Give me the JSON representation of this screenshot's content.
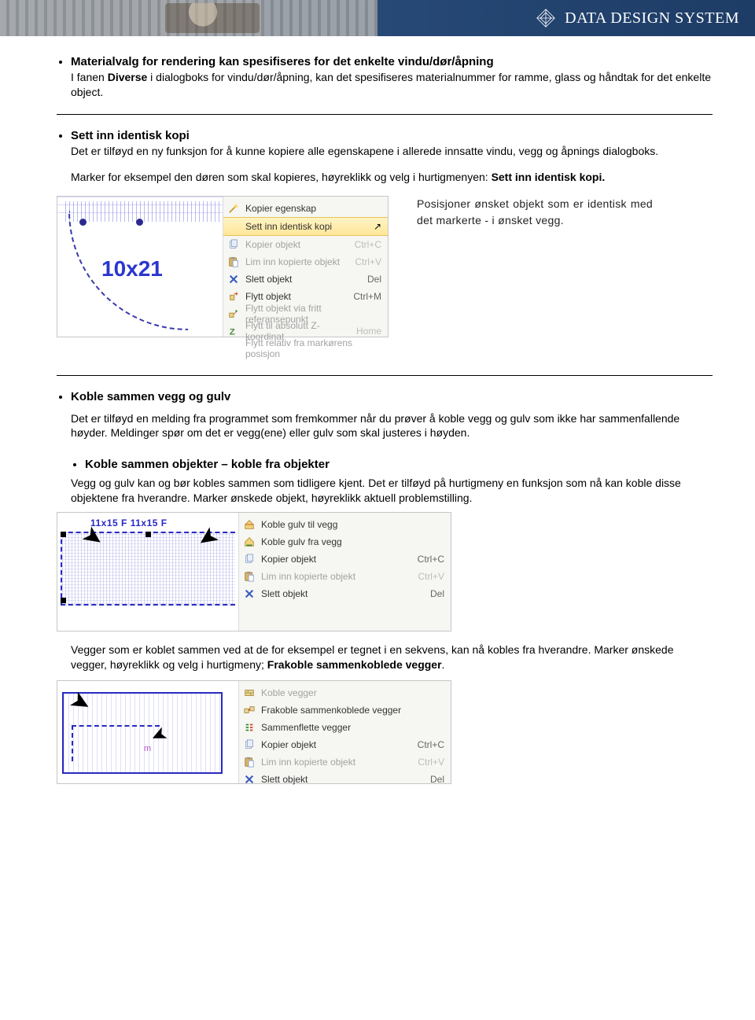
{
  "brand": "DATA DESIGN SYSTEM",
  "sections": {
    "s1": {
      "title": "Materialvalg for rendering kan spesifiseres for det enkelte vindu/dør/åpning",
      "body_pre": "I fanen ",
      "body_b": "Diverse",
      "body_post": " i dialogboks for vindu/dør/åpning, kan det spesifiseres materialnummer for ramme, glass og håndtak for det enkelte object."
    },
    "s2": {
      "title": "Sett inn identisk kopi",
      "p1": "Det er tilføyd en ny funksjon for å kunne kopiere alle egenskapene i allerede innsatte vindu, vegg og åpnings dialogboks.",
      "p2_pre": "Marker for eksempel den døren som skal kopieres, høyreklikk og velg i hurtigmenyen: ",
      "p2_b": "Sett inn identisk kopi.",
      "door_label": "10x21",
      "caption": "Posisjoner ønsket objekt som er identisk med det markerte - i ønsket vegg.",
      "menu": [
        {
          "icon": "wand",
          "label": "Kopier egenskap",
          "sc": "",
          "state": ""
        },
        {
          "icon": "",
          "label": "Sett inn identisk kopi",
          "sc": "",
          "state": "sel"
        },
        {
          "icon": "copy",
          "label": "Kopier objekt",
          "sc": "Ctrl+C",
          "state": "dis"
        },
        {
          "icon": "paste",
          "label": "Lim inn kopierte objekt",
          "sc": "Ctrl+V",
          "state": "dis"
        },
        {
          "icon": "x",
          "label": "Slett objekt",
          "sc": "Del",
          "state": ""
        },
        {
          "icon": "move",
          "label": "Flytt objekt",
          "sc": "Ctrl+M",
          "state": ""
        },
        {
          "icon": "moveref",
          "label": "Flytt objekt via fritt referansepunkt",
          "sc": "",
          "state": "dis"
        },
        {
          "icon": "z",
          "label": "Flytt til absolutt Z-koordinat",
          "sc": "Home",
          "state": "dis"
        },
        {
          "icon": "",
          "label": "Flytt relativ fra markørens posisjon",
          "sc": "",
          "state": "dis"
        }
      ]
    },
    "s3": {
      "title": "Koble sammen vegg og gulv",
      "p1": "Det er tilføyd en melding fra programmet som fremkommer når du prøver å koble vegg og gulv som ikke har sammenfallende høyder. Meldinger spør om det er vegg(ene) eller gulv som skal justeres i høyden.",
      "sub_title": "Koble sammen objekter – koble fra objekter",
      "p2": "Vegg og gulv kan og bør kobles sammen som tidligere kjent. Det er tilføyd på hurtigmeny en funksjon som nå kan koble disse objektene fra hverandre. Marker ønskede objekt, høyreklikk aktuell problemstilling.",
      "window_labels": "11x15 F   11x15 F",
      "menu2": [
        {
          "icon": "house",
          "label": "Koble gulv til vegg",
          "sc": "",
          "state": ""
        },
        {
          "icon": "house2",
          "label": "Koble gulv fra vegg",
          "sc": "",
          "state": ""
        },
        {
          "icon": "copy",
          "label": "Kopier objekt",
          "sc": "Ctrl+C",
          "state": ""
        },
        {
          "icon": "paste",
          "label": "Lim inn kopierte objekt",
          "sc": "Ctrl+V",
          "state": "dis"
        },
        {
          "icon": "x",
          "label": "Slett objekt",
          "sc": "Del",
          "state": ""
        }
      ],
      "p3_pre": "Vegger som er koblet sammen ved at de for eksempel er tegnet i en sekvens, kan nå kobles fra hverandre. Marker ønskede vegger, høyreklikk og velg i hurtigmeny; ",
      "p3_b": "Frakoble sammenkoblede vegger",
      "p3_post": ".",
      "menu3": [
        {
          "icon": "wall",
          "label": "Koble vegger",
          "sc": "",
          "state": "dis"
        },
        {
          "icon": "wall2",
          "label": "Frakoble sammenkoblede vegger",
          "sc": "",
          "state": ""
        },
        {
          "icon": "merge",
          "label": "Sammenflette vegger",
          "sc": "",
          "state": ""
        },
        {
          "icon": "copy",
          "label": "Kopier objekt",
          "sc": "Ctrl+C",
          "state": ""
        },
        {
          "icon": "paste",
          "label": "Lim inn kopierte objekt",
          "sc": "Ctrl+V",
          "state": "dis"
        },
        {
          "icon": "x",
          "label": "Slett objekt",
          "sc": "Del",
          "state": ""
        }
      ],
      "mref": "m"
    }
  }
}
